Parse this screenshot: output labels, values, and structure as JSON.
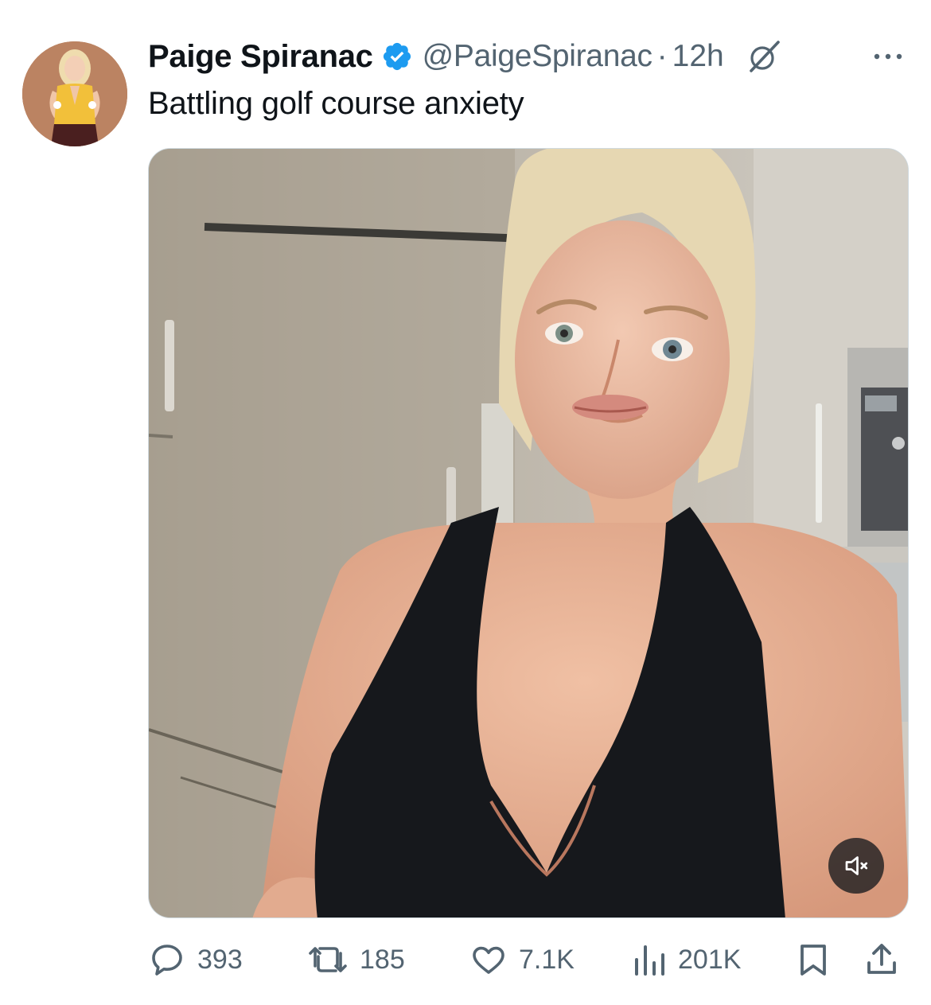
{
  "tweet": {
    "author": {
      "display_name": "Paige Spiranac",
      "handle": "@PaigeSpiranac",
      "verified": true,
      "verified_color": "#1d9bf0"
    },
    "separator": "·",
    "timestamp": "12h",
    "text": "Battling golf course anxiety",
    "media": {
      "type": "video",
      "muted": true
    },
    "icons": {
      "grok": "grok-icon",
      "more": "more-icon",
      "mute": "volume-mute-icon"
    },
    "stats": {
      "replies": "393",
      "retweets": "185",
      "likes": "7.1K",
      "views": "201K"
    }
  },
  "colors": {
    "text_primary": "#0f1419",
    "text_secondary": "#536471",
    "accent": "#1d9bf0"
  }
}
